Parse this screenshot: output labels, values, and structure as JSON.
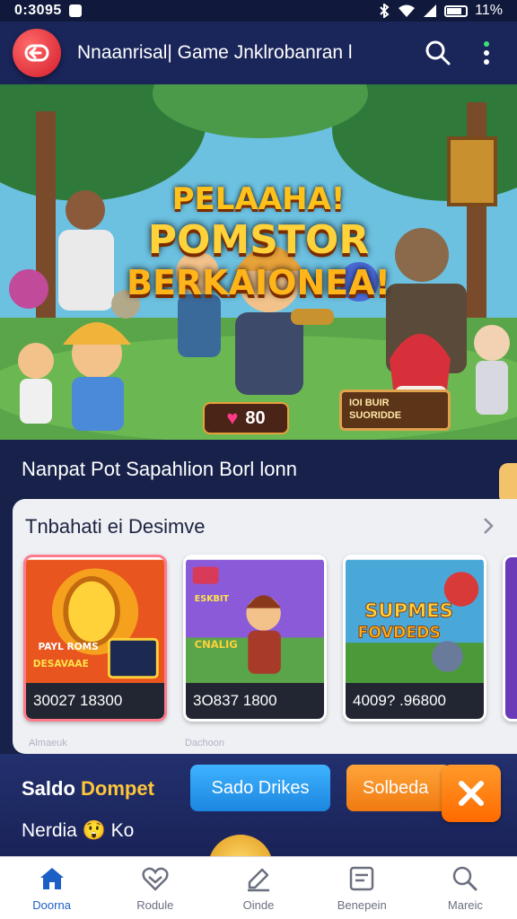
{
  "status": {
    "time": "0:3095",
    "right_text": "11%"
  },
  "app_bar": {
    "title": "Nnaanrisal| Game Jnklrobanran l"
  },
  "hero": {
    "title_line1": "PELAAHA!",
    "title_line2": "POMSTOR",
    "title_line3": "BERKAIONEA!",
    "gem_count": "80",
    "sign_line1": "IOI BUIR",
    "sign_line2": "SUORIDDE"
  },
  "section": {
    "heading": "Nanpat Pot Sapahlion Borl lonn"
  },
  "card_panel": {
    "title": "Tnbahati ei Desimve",
    "cards": [
      {
        "art_text1": "PAYL ROMS",
        "art_text2": "DESAVAAE",
        "price": "30027  18300"
      },
      {
        "art_text1": "ESKBIT",
        "art_text2": "CNALIG",
        "price": "3O837  1800"
      },
      {
        "art_text1": "SUPMES",
        "art_text2": "FOVDEDS",
        "price": "4009?  .96800"
      }
    ],
    "captions": [
      "Almaeuk",
      "Dachoon"
    ]
  },
  "wallet": {
    "label_white": "Saldo ",
    "label_highlight": "Dompet",
    "sub_label": "Nerdia 😲 Ko",
    "btn_blue": "Sado Drikes",
    "btn_orange": "Solbeda"
  },
  "nav": {
    "items": [
      {
        "label": "Doorna",
        "icon": "home-icon"
      },
      {
        "label": "Rodule",
        "icon": "heart-shield-icon"
      },
      {
        "label": "Oinde",
        "icon": "edit-icon"
      },
      {
        "label": "Benepein",
        "icon": "list-icon"
      },
      {
        "label": "Mareic",
        "icon": "search-icon"
      }
    ]
  },
  "colors": {
    "app_bar": "#1a2559",
    "accent_blue": "#1d5fc4",
    "accent_orange": "#ff7a10",
    "back_red": "#d21c2a"
  }
}
